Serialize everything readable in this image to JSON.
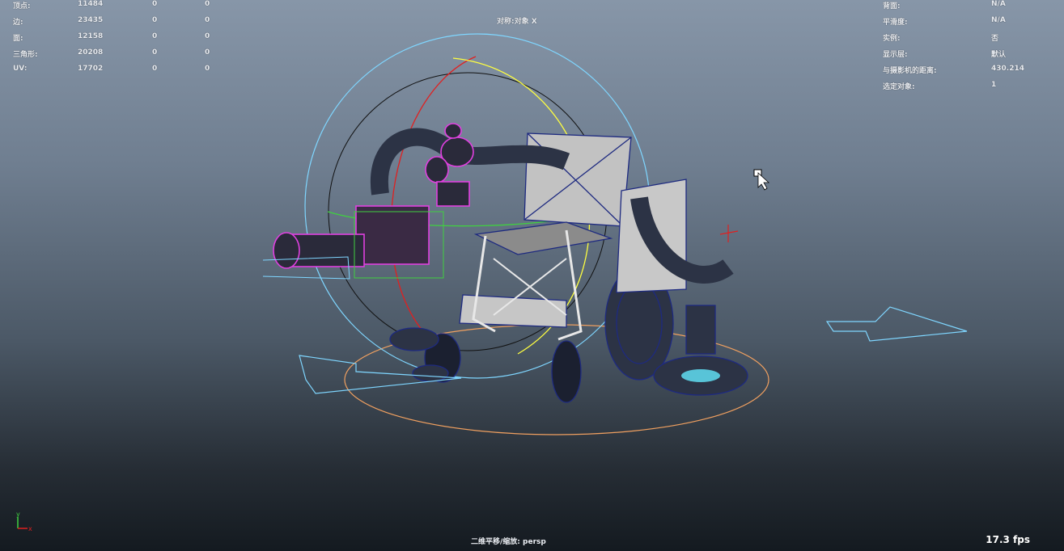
{
  "stats": [
    {
      "label": "顶点:",
      "count": "11484",
      "sel": "0",
      "extra": "0"
    },
    {
      "label": "边:",
      "count": "23435",
      "sel": "0",
      "extra": "0"
    },
    {
      "label": "面:",
      "count": "12158",
      "sel": "0",
      "extra": "0"
    },
    {
      "label": "三角形:",
      "count": "20208",
      "sel": "0",
      "extra": "0"
    },
    {
      "label": "UV:",
      "count": "17702",
      "sel": "0",
      "extra": "0"
    }
  ],
  "symmetry": "对称:对象 X",
  "info": [
    {
      "label": "背面:",
      "value": "N/A"
    },
    {
      "label": "平滑度:",
      "value": "N/A"
    },
    {
      "label": "实例:",
      "value": "否"
    },
    {
      "label": "显示层:",
      "value": "默认"
    },
    {
      "label": "与摄影机的距离:",
      "value": "430.214"
    },
    {
      "label": "选定对象:",
      "value": "1"
    }
  ],
  "camera_label": "二维平移/缩放: persp",
  "fps": "17.3 fps",
  "axis": {
    "y": "y",
    "x": "x"
  },
  "colors": {
    "viewport_top": "#8796a8",
    "viewport_bottom": "#141a20",
    "wire_blue": "#1e2a80",
    "selection_magenta": "#e040e0",
    "gizmo_cyan": "#7fd6ff",
    "gizmo_yellow": "#ffff40",
    "gizmo_red": "#e02020",
    "ground_orange": "#f0a060"
  }
}
